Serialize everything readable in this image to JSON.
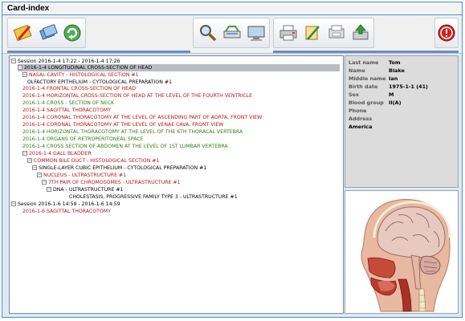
{
  "window": {
    "title": "Card-index"
  },
  "toolbar": {
    "buttons": [
      {
        "icon": "edit-card-icon"
      },
      {
        "icon": "copy-card-icon"
      },
      {
        "icon": "refresh-icon"
      },
      {
        "icon": "search-zoom-icon"
      },
      {
        "icon": "scanner-icon"
      },
      {
        "icon": "monitor-icon"
      },
      {
        "icon": "printer-icon"
      },
      {
        "icon": "export-icon"
      },
      {
        "icon": "print-preview-icon"
      },
      {
        "icon": "save-disk-icon"
      },
      {
        "icon": "alert-icon"
      }
    ]
  },
  "tree": {
    "rows": [
      {
        "text": "Session 2016-1-4 17:22 - 2016-1-4 17:26",
        "color": "black",
        "expander": "-"
      },
      {
        "text": "2016-1-4  LONGITUDINAL CROSS-SECTION OF HEAD",
        "color": "black",
        "expander": "-"
      },
      {
        "text": "NASAL CAVITY - HISTOLOGICAL SECTION #1",
        "color": "red",
        "expander": "-"
      },
      {
        "text": "OLFACTORY EPITHELIUM - CYTOLOGICAL PREPARATION #1",
        "color": "black",
        "expander": ""
      },
      {
        "text": "2016-1-4  FRONTAL CROSS-SECTION OF HEAD",
        "color": "red",
        "expander": ""
      },
      {
        "text": "2016-1-4  HORIZONTAL CROSS-SECTION OF HEAD AT THE LEVEL OF THE FOURTH VENTRICLE",
        "color": "red",
        "expander": ""
      },
      {
        "text": "2016-1-4  CROSS - SECTION OF NECK",
        "color": "green",
        "expander": ""
      },
      {
        "text": "2016-1-4  SAGITTAL THORACOTOMY",
        "color": "red",
        "expander": ""
      },
      {
        "text": "2016-1-4  CORONAL THORACOTOMY AT THE LEVEL OF ASCENDING PART OF AORTA, FRONT VIEW",
        "color": "red",
        "expander": ""
      },
      {
        "text": "2016-1-4  CORONAL THORACOTOMY AT THE LEVEL OF VENAE CAVA, FRONT VIEW",
        "color": "red",
        "expander": ""
      },
      {
        "text": "2016-1-4  HORIZONTAL THORACOTOMY AT THE LEVEL OF THE 6TH THORACAL VERTEBRA",
        "color": "green",
        "expander": ""
      },
      {
        "text": "2016-1-4  ORGANS OF RETROPERITONEAL SPACE",
        "color": "green",
        "expander": ""
      },
      {
        "text": "2016-1-4  CROSS SECTION OF ABDOMEN AT THE LEVEL OF 1ST LUMBAR VERTEBRA",
        "color": "green",
        "expander": ""
      },
      {
        "text": "2016-1-4  GALL BLADDER",
        "color": "red",
        "expander": "-"
      },
      {
        "text": "COMMON BILE DUCT - HISTOLOGICAL SECTION #1",
        "color": "red",
        "expander": "-"
      },
      {
        "text": "SINGLE-LAYER CUBIC EPITHELIUM - CYTOLOGICAL PREPARATION #1",
        "color": "black",
        "expander": "-"
      },
      {
        "text": "NUCLEUS - ULTRASTRUCTURE #1",
        "color": "red",
        "expander": "-"
      },
      {
        "text": "7TH PAIR OF CHROMOSOMES - ULTRASTRUCTURE #1",
        "color": "red",
        "expander": "-"
      },
      {
        "text": "DNA - ULTRASTRUCTURE #1",
        "color": "black",
        "expander": "-"
      },
      {
        "text": "CHOLESTASIS, PROGRESSIVE FAMILY TYPE 3 - ULTRASTRUCTURE #1",
        "color": "black",
        "expander": ""
      },
      {
        "text": "Session 2016-1-6 14:59 - 2016-1-6 14:59",
        "color": "black",
        "expander": "-"
      },
      {
        "text": "2016-1-6  SAGITTAL THORACOTOMY",
        "color": "red",
        "expander": ""
      }
    ]
  },
  "patient": {
    "fields": [
      {
        "label": "Last name",
        "value": "Tom"
      },
      {
        "label": "Name",
        "value": "Blake"
      },
      {
        "label": "Middle name",
        "value": "Ian"
      },
      {
        "label": "Birth date",
        "value": "1975-1-1 (41)"
      },
      {
        "label": "Sex",
        "value": "M"
      },
      {
        "label": "Blood group",
        "value": "II(A)"
      },
      {
        "label": "Phone",
        "value": ""
      },
      {
        "label": "Address",
        "value": ""
      },
      {
        "label": "",
        "value": "America"
      }
    ]
  },
  "colors": {
    "red": "#b81414",
    "green": "#2e7d12",
    "black": "#000000",
    "accent": "#4a90d9"
  }
}
